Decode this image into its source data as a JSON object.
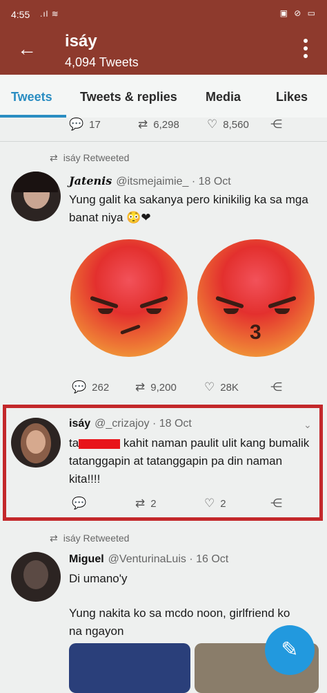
{
  "status_bar": {
    "time": "4:55",
    "signal": ".ıl ≋",
    "right_icons": "▣ ⊘ ▭"
  },
  "header": {
    "name": "isáy",
    "tweet_count": "4,094 Tweets"
  },
  "tabs": [
    "Tweets",
    "Tweets & replies",
    "Media",
    "Likes"
  ],
  "top_actions": {
    "replies": "17",
    "retweets": "6,298",
    "likes": "8,560"
  },
  "tweets": [
    {
      "retweet_label": "isáy Retweeted",
      "name": "Jatenis",
      "handle": "@itsmejaimie_",
      "date": "· 18 Oct",
      "text": "Yung galit ka sakanya pero kinikilig ka sa mga banat niya 😳❤",
      "replies": "262",
      "retweets": "9,200",
      "likes": "28K"
    },
    {
      "name": "isáy",
      "handle": "@_crizajoy",
      "date": "· 18 Oct",
      "text_line1_prefix": "ta",
      "text_line1": "kahit naman paulit ulit kang",
      "text_rest": "bumalik tatanggapin at tatanggapin pa din naman kita!!!!",
      "replies": "",
      "retweets": "2",
      "likes": "2"
    },
    {
      "retweet_label": "isáy Retweeted",
      "name": "Miguel",
      "handle": "@VenturinaLuis",
      "date": "· 16 Oct",
      "text1": "Di umano'y",
      "text2": "Yung nakita ko sa mcdo noon, girlfriend ko na ngayon"
    }
  ],
  "icons": {
    "back": "arrow-left",
    "reply": "speech-bubble",
    "retweet": "retweet-arrows",
    "like": "heart",
    "share": "share-nodes",
    "fab": "compose-feather"
  },
  "colors": {
    "header": "#8e3a2d",
    "accent": "#2a8dc2",
    "highlight": "#c3282b",
    "fab": "#2299de"
  }
}
